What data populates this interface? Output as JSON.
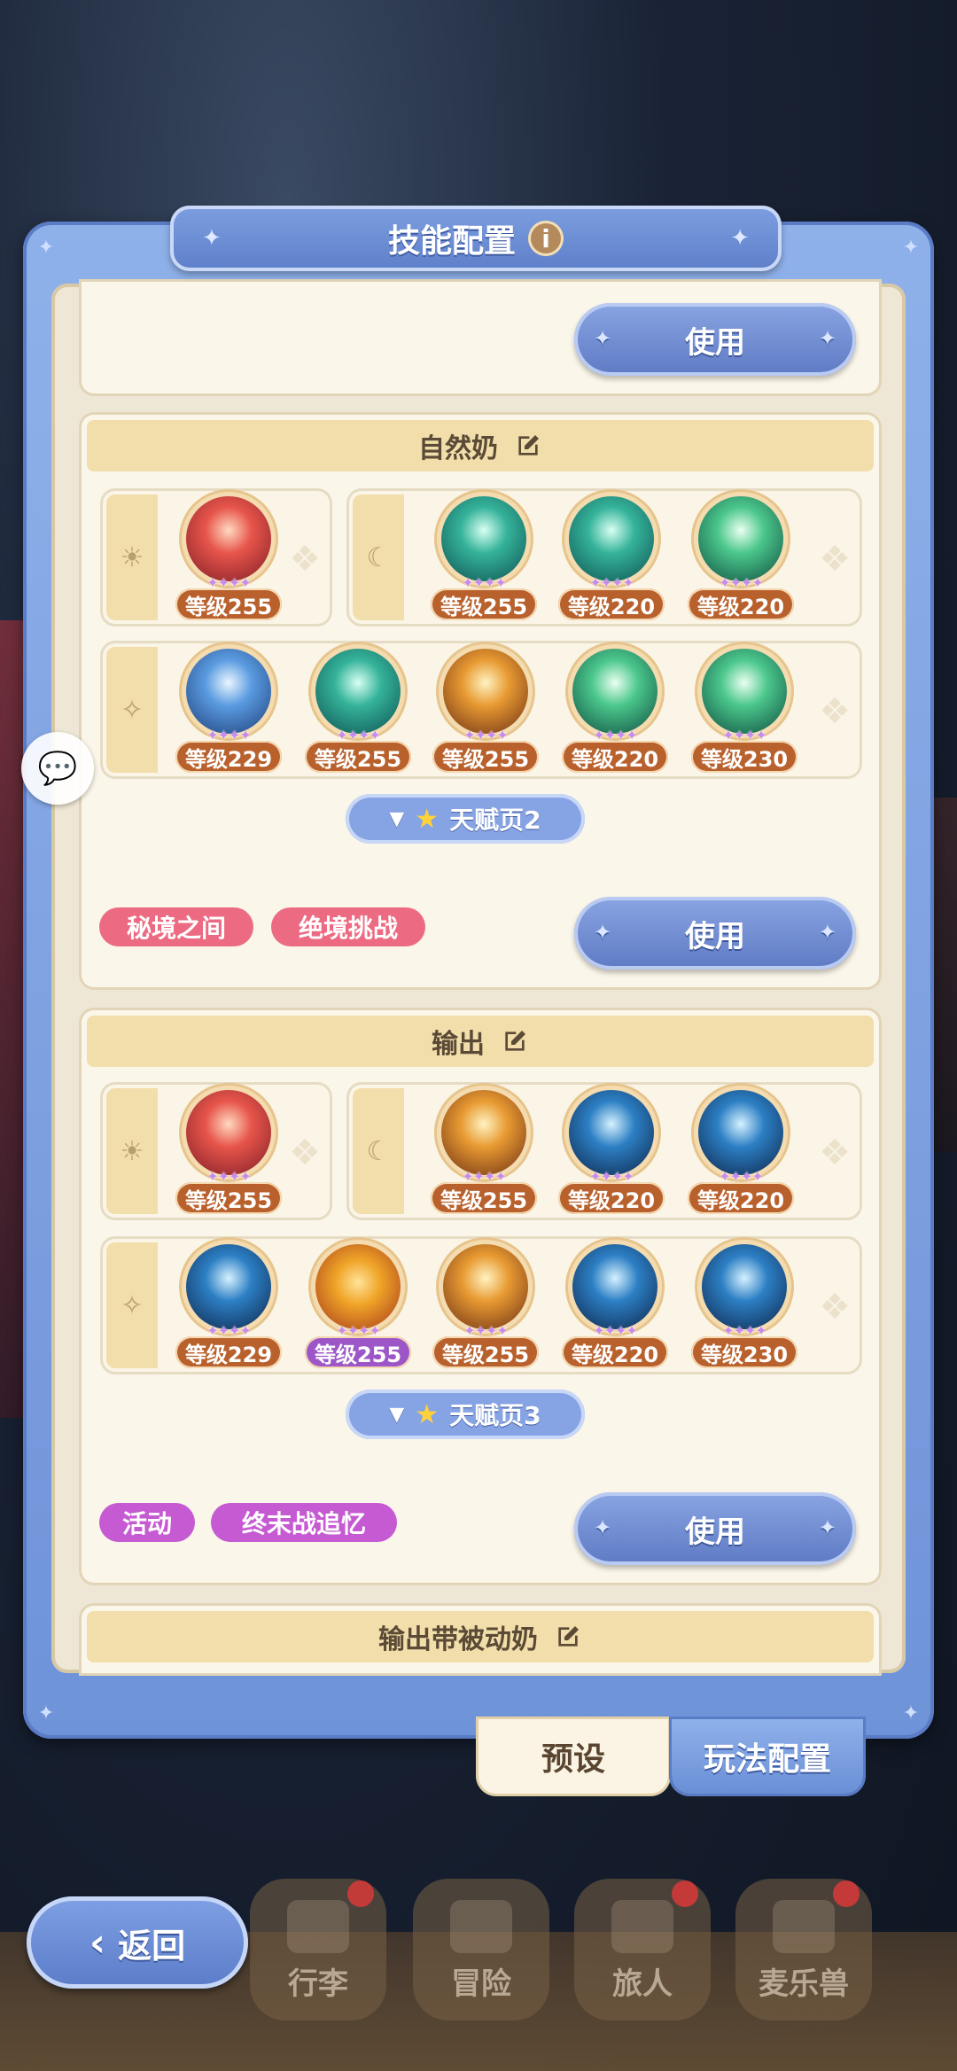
{
  "title": "技能配置",
  "info_icon_label": "i",
  "use_label": "使用",
  "loadouts": [
    {
      "name": "自然奶",
      "sun_skills": [
        {
          "level": "等级255",
          "tone": "o-red"
        }
      ],
      "moon_skills": [
        {
          "level": "等级255",
          "tone": "o-teal"
        },
        {
          "level": "等级220",
          "tone": "o-teal"
        },
        {
          "level": "等级220",
          "tone": "o-green"
        }
      ],
      "star_skills": [
        {
          "level": "等级229",
          "tone": "o-blue"
        },
        {
          "level": "等级255",
          "tone": "o-teal"
        },
        {
          "level": "等级255",
          "tone": "o-gold"
        },
        {
          "level": "等级220",
          "tone": "o-green"
        },
        {
          "level": "等级230",
          "tone": "o-green"
        }
      ],
      "talent_page": "天赋页2",
      "tags": [
        "秘境之间",
        "绝境挑战"
      ]
    },
    {
      "name": "输出",
      "sun_skills": [
        {
          "level": "等级255",
          "tone": "o-red"
        }
      ],
      "moon_skills": [
        {
          "level": "等级255",
          "tone": "o-gold"
        },
        {
          "level": "等级220",
          "tone": "o-navy"
        },
        {
          "level": "等级220",
          "tone": "o-navy"
        }
      ],
      "star_skills": [
        {
          "level": "等级229",
          "tone": "o-navy"
        },
        {
          "level": "等级255",
          "tone": "o-sun"
        },
        {
          "level": "等级255",
          "tone": "o-gold"
        },
        {
          "level": "等级220",
          "tone": "o-navy"
        },
        {
          "level": "等级230",
          "tone": "o-navy"
        }
      ],
      "talent_page": "天赋页3",
      "tags": [
        "活动",
        "终末战追忆"
      ]
    },
    {
      "name": "输出带被动奶"
    }
  ],
  "bottom_tabs": {
    "preset": "预设",
    "play_config": "玩法配置"
  },
  "nav": {
    "back": "返回",
    "items": [
      "行李",
      "冒险",
      "旅人",
      "麦乐兽"
    ]
  },
  "colors": {
    "panel_blue": "#6f93d8",
    "parchment": "#fbf6ea",
    "level_badge": "#b9612d",
    "level_badge_purple": "#9c56c8",
    "tag_pink": "#ec6b82",
    "tag_violet": "#c65ad2"
  }
}
